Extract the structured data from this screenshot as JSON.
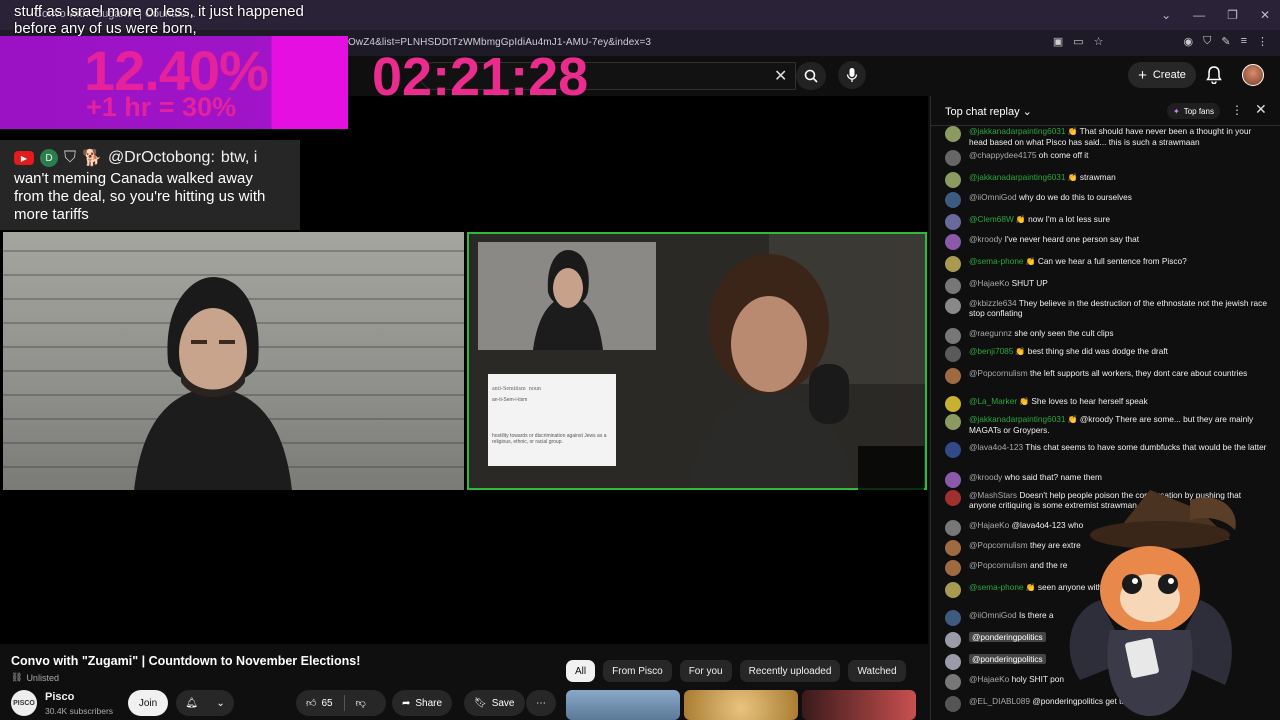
{
  "browser": {
    "tab_title": "Convo with \"Zugami\" | Countdo...",
    "url": "OwZ4&list=PLNHSDDtTzWMbmgGpIdiAu4mJ1-AMU-7ey&index=3"
  },
  "overlay": {
    "caption": "stuff as Israel more or less, it just happened before any of us were born,",
    "percent": "12.40%",
    "hour_note": "+1 hr = 30%",
    "timer": "02:21:28",
    "chat_badge_letter": "D",
    "chat_user": "@DrOctobong:",
    "chat_text_1": "btw, i",
    "chat_text_2": "wan't meming Canada walked away from the deal, so you're hitting us with more tariffs",
    "pip_card_title": "anti-Semitism",
    "pip_card_pos": "noun",
    "pip_card_line1": "an-ti-Sem-i-tism",
    "pip_card_line2": "hostility towards or discrimination against Jews as a religious, ethnic, or racial group."
  },
  "youtube": {
    "create_label": "Create"
  },
  "video": {
    "title": "Convo with \"Zugami\" | Countdown to November Elections!",
    "unlisted": "Unlisted",
    "channel": "Pisco",
    "channel_avatar": "PISCO",
    "subscribers": "30.4K subscribers",
    "join": "Join",
    "likes": "65",
    "share": "Share",
    "save": "Save"
  },
  "chips": [
    "All",
    "From Pisco",
    "For you",
    "Recently uploaded",
    "Watched"
  ],
  "chat": {
    "title": "Top chat replay",
    "top_fans": "Top fans",
    "messages": [
      {
        "user": "@jakkanadarpainting6031",
        "text": "That should have never been a thought in your head based on what Pisco has said... this is such a strawmaan",
        "green": true,
        "color": "#8a9a60"
      },
      {
        "user": "@chappydee4175",
        "text": "oh come off it",
        "green": false,
        "color": "#666"
      },
      {
        "user": "@jakkanadarpainting6031",
        "text": "strawman",
        "green": true,
        "color": "#8a9a60"
      },
      {
        "user": "@iiOmniGod",
        "text": "why do we do this to ourselves",
        "green": false,
        "color": "#3d5a80"
      },
      {
        "user": "@Clem68W",
        "text": "now I'm a lot less sure",
        "green": true,
        "color": "#6a6a9a"
      },
      {
        "user": "@kroody",
        "text": "I've never heard one person say that",
        "green": false,
        "color": "#8a5aa8"
      },
      {
        "user": "@sema-phone",
        "text": "Can we hear a full sentence from Pisco?",
        "green": true,
        "color": "#a89a50"
      },
      {
        "user": "@HajaeKo",
        "text": "SHUT UP",
        "green": false,
        "color": "#777"
      },
      {
        "user": "@kbizzle634",
        "text": "They believe in the destruction of the ethnostate not the jewish race stop conflating",
        "green": false,
        "color": "#888"
      },
      {
        "user": "@raegunnz",
        "text": "she only seen the cult clips",
        "green": false,
        "color": "#777"
      },
      {
        "user": "@benji7085",
        "text": "best thing she did was dodge the draft",
        "green": true,
        "color": "#5a5a5a"
      },
      {
        "user": "@Popcornulism",
        "text": "the left supports all workers, they dont care about countries",
        "green": false,
        "color": "#a06a40"
      },
      {
        "user": "@La_Marker",
        "text": "She loves to hear herself speak",
        "green": true,
        "color": "#c8b030"
      },
      {
        "user": "@jakkanadarpainting6031",
        "text": "@kroody There are some... but they are mainly MAGATs or Groypers.",
        "green": true,
        "color": "#8a9a60"
      },
      {
        "user": "@lava4o4-123",
        "text": "This chat seems to have some dumbfucks that would be the latter",
        "green": false,
        "color": "#304a8a"
      },
      {
        "user": "@kroody",
        "text": "who said that? name them",
        "green": false,
        "color": "#8a5aa8"
      },
      {
        "user": "@MashStars",
        "text": "Doesn't help people poison the conversation by pushing that anyone critiquing is some extremist strawman",
        "green": false,
        "color": "#a03030"
      },
      {
        "user": "@HajaeKo",
        "text": "@lava4o4-123 who",
        "green": false,
        "color": "#777"
      },
      {
        "user": "@Popcornulism",
        "text": "they are extre",
        "green": false,
        "color": "#a06a40"
      },
      {
        "user": "@Popcornulism",
        "text": "and the re",
        "green": false,
        "color": "#a06a40"
      },
      {
        "user": "@sema-phone",
        "text": "seen anyone with that belief in America",
        "green": true,
        "color": "#a89a50"
      },
      {
        "user": "@iiOmniGod",
        "text": "Is there a",
        "green": false,
        "color": "#3d5a80"
      },
      {
        "user": "@ponderingpolitics",
        "text": "",
        "green": false,
        "hl": true,
        "color": "#9a9aa8"
      },
      {
        "user": "@ponderingpolitics",
        "text": "",
        "green": false,
        "hl": true,
        "color": "#9a9aa8"
      },
      {
        "user": "@HajaeKo",
        "text": "holy SHIT pon",
        "green": false,
        "color": "#777"
      },
      {
        "user": "@EL_DIABL089",
        "text": "@ponderingpolitics get the popcorn",
        "green": false,
        "color": "#555"
      }
    ]
  },
  "colors": {
    "accent_pink": "#ec2b8e",
    "overlay_purple": "#a114c8",
    "verified_green": "#2ba640"
  }
}
